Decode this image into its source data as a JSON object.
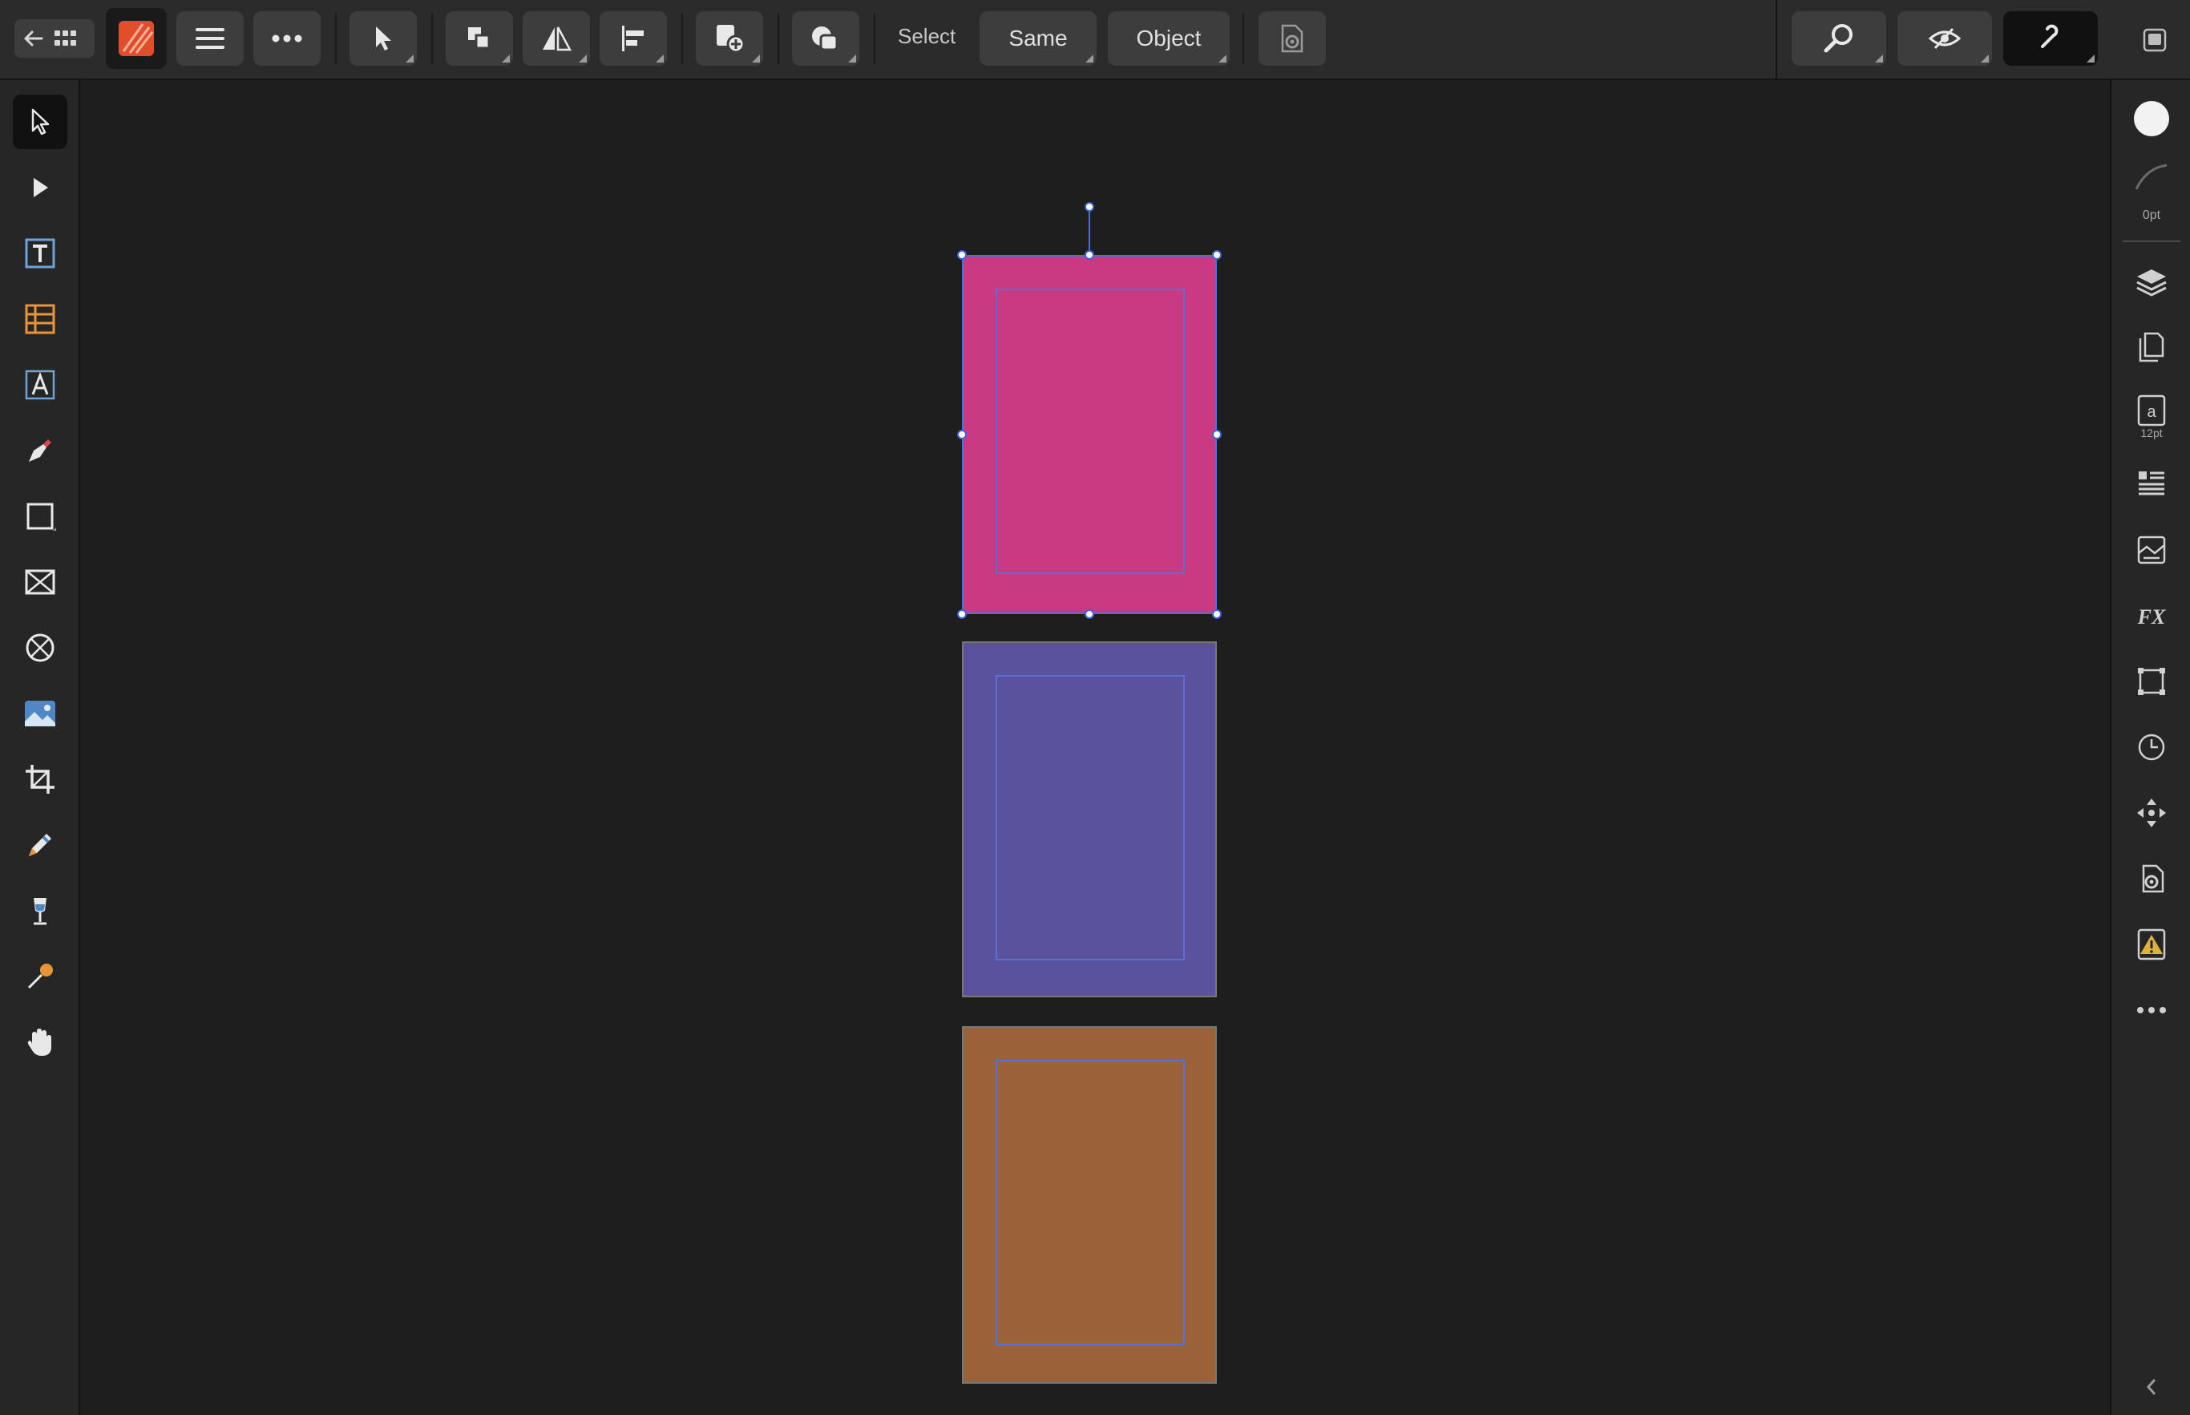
{
  "app": {
    "name": "Affinity Publisher"
  },
  "toolbar": {
    "select_label": "Select",
    "same_label": "Same",
    "object_label": "Object"
  },
  "studio": {
    "stroke_width": "0pt",
    "text_size": "12pt"
  },
  "colors": {
    "page_1": "#c93a82",
    "page_2": "#5a529d",
    "page_3": "#9a6238",
    "margin_guide": "#5e6ed9",
    "selection": "#4a72e0",
    "warning": "#e0b23c"
  },
  "icons": {
    "top": [
      "back-arrow-icon",
      "grid-icon",
      "app-logo-icon",
      "hamburger-menu-icon",
      "more-icon",
      "move-tool-icon",
      "arrange-icon",
      "flip-icon",
      "align-icon",
      "insert-icon",
      "boolean-icon",
      "document-settings-icon",
      "zoom-icon",
      "preview-icon",
      "snapping-icon",
      "window-icon"
    ],
    "left": [
      "move-tool-icon",
      "node-tool-icon",
      "frame-text-icon",
      "table-icon",
      "artistic-text-icon",
      "pen-icon",
      "rectangle-icon",
      "picture-frame-icon",
      "ellipse-frame-icon",
      "place-image-icon",
      "crop-icon",
      "pencil-icon",
      "fill-icon",
      "color-picker-icon",
      "hand-icon"
    ],
    "right": [
      "fill-color-icon",
      "stroke-icon",
      "layers-icon",
      "pages-icon",
      "text-style-icon",
      "paragraph-icon",
      "resource-icon",
      "fx-icon",
      "transform-icon",
      "history-icon",
      "navigator-icon",
      "settings-icon",
      "preflight-warning-icon",
      "more-icon",
      "collapse-icon"
    ]
  }
}
